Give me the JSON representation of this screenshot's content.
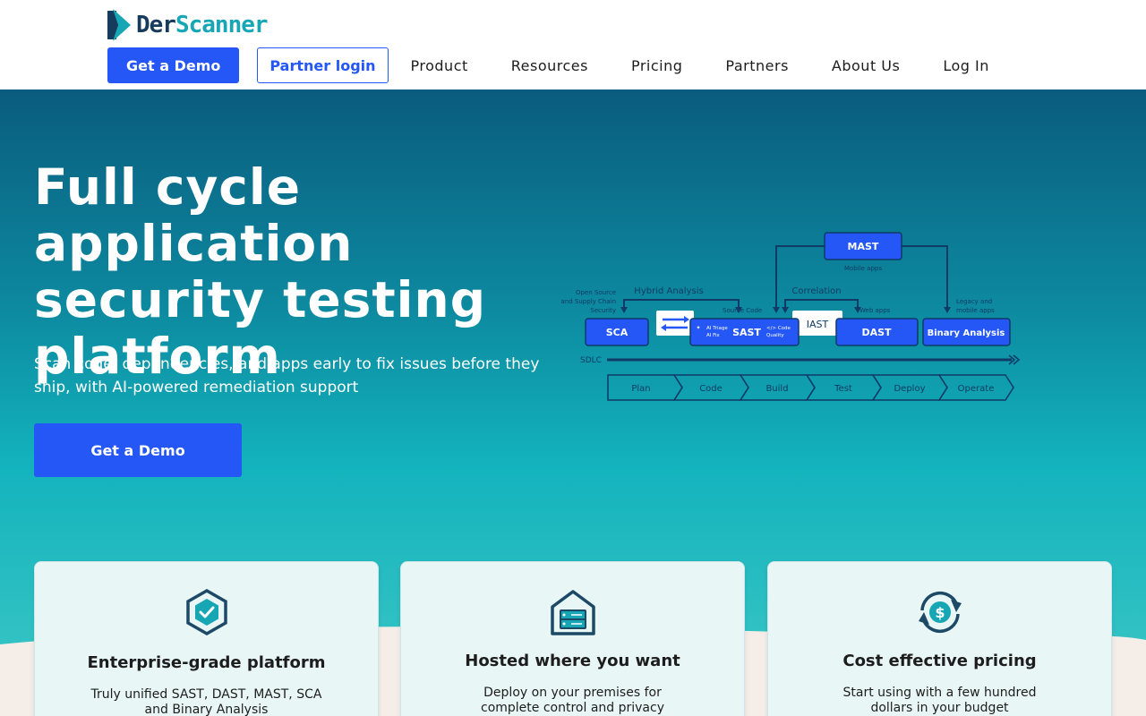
{
  "brand": {
    "name_part1": "Der",
    "name_part2": "Scanner",
    "primary_color": "#2457f5",
    "accent_color": "#17a6b4"
  },
  "nav": {
    "demo_label": "Get a Demo",
    "partner_label": "Partner login",
    "links": [
      "Product",
      "Resources",
      "Pricing",
      "Partners",
      "About Us",
      "Log In"
    ]
  },
  "hero": {
    "title": "Full cycle application security testing platform",
    "subtitle": "Scan code, dependencies, and apps early to fix issues before they ship, with AI-powered remediation support",
    "cta_label": "Get a Demo"
  },
  "diagram": {
    "mast": "MAST",
    "mobile_apps": "Mobile apps",
    "hybrid_analysis": "Hybrid Analysis",
    "correlation": "Correlation",
    "open_source": "Open Source",
    "supply_chain": "and Supply Chain",
    "security": "Security",
    "source_code": "Source Code",
    "web_apps": "Web apps",
    "legacy": "Legacy and",
    "mobile_apps2": "mobile apps",
    "sca": "SCA",
    "sast": "SAST",
    "ai_triage": "AI Triage",
    "ai_fix": "AI Fix",
    "code": "</> Code",
    "quality": "Quality",
    "iast": "IAST",
    "dast": "DAST",
    "binary": "Binary Analysis",
    "sdlc": "SDLC",
    "stages": [
      "Plan",
      "Code",
      "Build",
      "Test",
      "Deploy",
      "Operate"
    ]
  },
  "cards": [
    {
      "icon": "shield-check-icon",
      "title": "Enterprise-grade platform",
      "text": "Truly unified SAST, DAST, MAST, SCA and Binary Analysis"
    },
    {
      "icon": "server-house-icon",
      "title": "Hosted where you want",
      "text": "Deploy on your premises for complete control and privacy"
    },
    {
      "icon": "dollar-cycle-icon",
      "title": "Cost effective pricing",
      "text": "Start using with a few hundred dollars in your budget"
    }
  ]
}
